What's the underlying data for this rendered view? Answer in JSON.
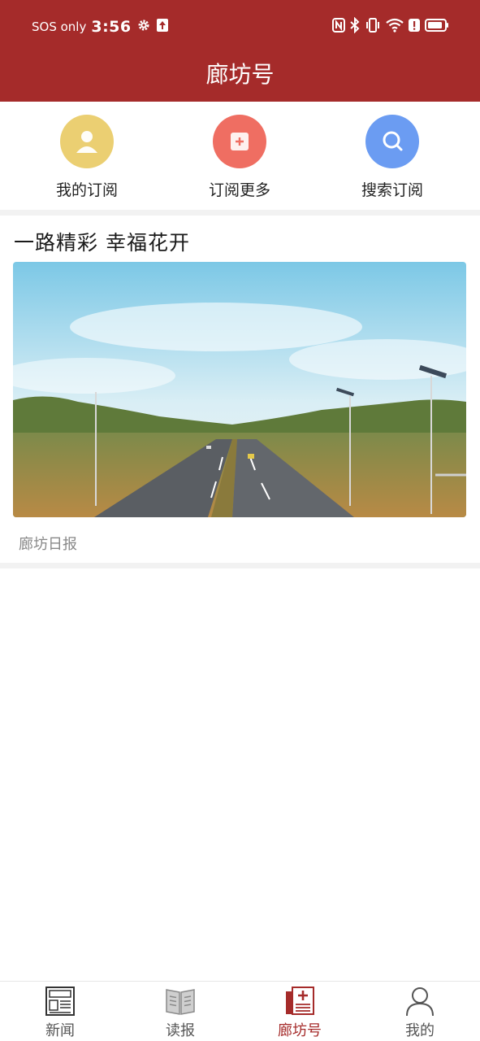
{
  "status_bar": {
    "carrier": "SOS only",
    "time": "3:56",
    "icons": [
      "gear-icon",
      "upload-icon",
      "nfc-icon",
      "bluetooth-icon",
      "vibrate-icon",
      "wifi-icon",
      "alert-icon",
      "battery-icon"
    ]
  },
  "header": {
    "title": "廊坊号"
  },
  "quick_actions": [
    {
      "label": "我的订阅",
      "icon": "user-icon",
      "color": "#ebcf72"
    },
    {
      "label": "订阅更多",
      "icon": "add-icon",
      "color": "#ef6e62"
    },
    {
      "label": "搜索订阅",
      "icon": "search-icon",
      "color": "#6b9cf2"
    }
  ],
  "feed": [
    {
      "title": "一路精彩  幸福花开",
      "source": "廊坊日报"
    }
  ],
  "tabs": [
    {
      "label": "新闻",
      "icon": "news-icon",
      "active": false
    },
    {
      "label": "读报",
      "icon": "book-icon",
      "active": false
    },
    {
      "label": "廊坊号",
      "icon": "news-add-icon",
      "active": true
    },
    {
      "label": "我的",
      "icon": "person-icon",
      "active": false
    }
  ],
  "colors": {
    "brand": "#a52b2a",
    "inactive_tab": "#555555"
  }
}
